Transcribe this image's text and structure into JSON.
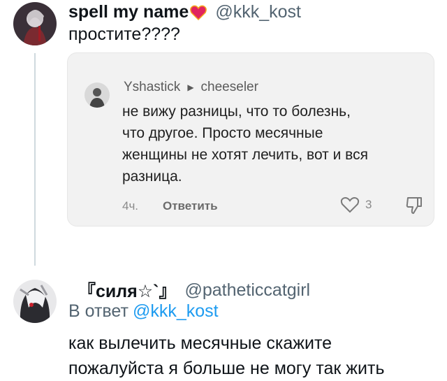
{
  "post": {
    "author_name": "spell my name",
    "author_handle": "@kkk_kost",
    "text": "простите????"
  },
  "quoted_comment": {
    "author": "Yshastick",
    "reply_to": "cheeseler",
    "lines": [
      "не вижу разницы, что то болезнь,",
      "что другое. Просто месячные",
      "женщины не хотят лечить, вот и вся",
      "разница."
    ],
    "time": "4ч.",
    "reply_label": "Ответить",
    "like_count": "3"
  },
  "reply": {
    "author_name": "『силя☆`』",
    "author_handle": "@patheticcatgirl",
    "reply_prefix": "В ответ",
    "reply_mention": "@kkk_kost",
    "lines": [
      "как вылечить месячные скажите",
      "пожалуйста я больше не могу так жить"
    ]
  },
  "colors": {
    "handle_gray": "#536471",
    "mention_blue": "#1d9bf0",
    "card_bg": "#f2f2f2",
    "thread_line": "#cfd9de"
  }
}
